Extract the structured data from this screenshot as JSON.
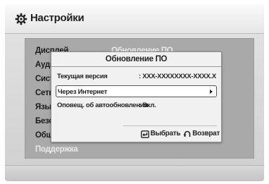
{
  "header": {
    "title": "Настройки",
    "icon": "gear-icon"
  },
  "menu": {
    "items": [
      {
        "label": "Дисплей",
        "dim": false
      },
      {
        "label": "Аудио",
        "dim": false
      },
      {
        "label": "Система",
        "dim": false
      },
      {
        "label": "Сеть",
        "dim": false
      },
      {
        "label": "Язык",
        "dim": false
      },
      {
        "label": "Безопасность",
        "dim": false
      },
      {
        "label": "Общее",
        "dim": false
      },
      {
        "label": "Поддержка",
        "dim": true
      }
    ]
  },
  "right_panel": {
    "title": "Обновление ПО"
  },
  "dialog": {
    "title": "Обновление ПО",
    "rows": [
      {
        "label": "Текущая версия",
        "value": ": XXX-XXXXXXXX-XXXX.X"
      },
      {
        "label": "Через Интернет",
        "value": ""
      },
      {
        "label": "Оповещ. об автообновлении",
        "value": ": Вкл."
      }
    ],
    "footer": {
      "select_label": "Выбрать",
      "return_label": "Возврат"
    }
  },
  "colors": {
    "panel_bg": "#a9a9a9",
    "dialog_bg": "#f1f1f1",
    "selected_bg": "#ffffff",
    "dim_text": "#e9e9e9"
  }
}
